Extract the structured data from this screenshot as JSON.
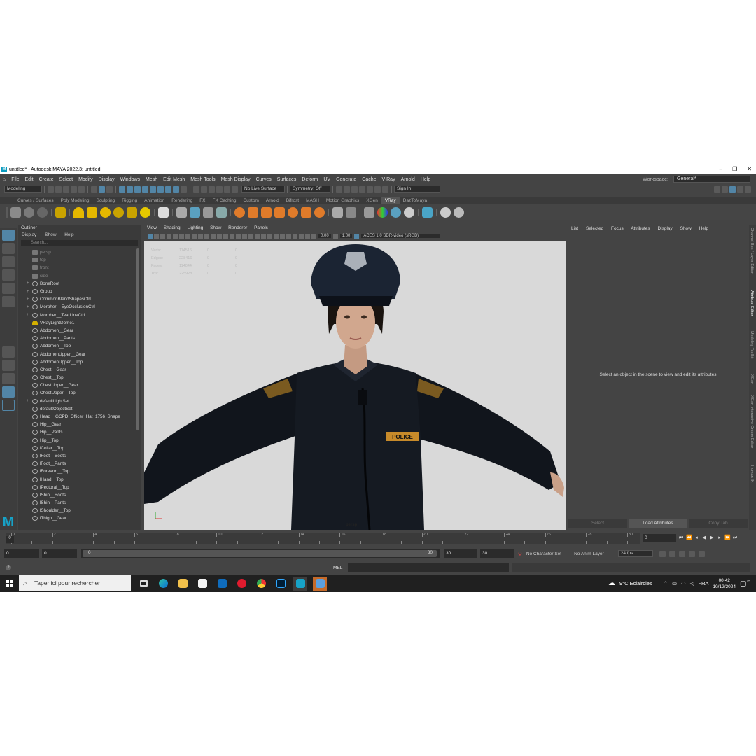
{
  "window": {
    "title": "untitled* - Autodesk MAYA 2022.3: untitled"
  },
  "menu": [
    "File",
    "Edit",
    "Create",
    "Select",
    "Modify",
    "Display",
    "Windows",
    "Mesh",
    "Edit Mesh",
    "Mesh Tools",
    "Mesh Display",
    "Curves",
    "Surfaces",
    "Deform",
    "UV",
    "Generate",
    "Cache",
    "V-Ray",
    "Arnold",
    "Help"
  ],
  "workspace": {
    "label": "Workspace:",
    "value": "General*"
  },
  "status": {
    "mode": "Modeling",
    "live_surface": "No Live Surface",
    "symmetry": "Symmetry: Off",
    "sign_in": "Sign In"
  },
  "shelf_tabs": [
    "Curves / Surfaces",
    "Poly Modeling",
    "Sculpting",
    "Rigging",
    "Animation",
    "Rendering",
    "FX",
    "FX Caching",
    "Custom",
    "Arnold",
    "Bifrost",
    "MASH",
    "Motion Graphics",
    "XGen",
    "VRay",
    "DazToMaya"
  ],
  "shelf_active": "VRay",
  "outliner": {
    "title": "Outliner",
    "menu": [
      "Display",
      "Show",
      "Help"
    ],
    "search_placeholder": "Search...",
    "items": [
      {
        "label": "persp",
        "kind": "cam",
        "exp": ""
      },
      {
        "label": "top",
        "kind": "cam",
        "exp": ""
      },
      {
        "label": "front",
        "kind": "cam",
        "exp": ""
      },
      {
        "label": "side",
        "kind": "cam",
        "exp": ""
      },
      {
        "label": "BoneRoot",
        "kind": "node",
        "exp": "+"
      },
      {
        "label": "Group",
        "kind": "node",
        "exp": "+"
      },
      {
        "label": "CommonBlendShapesCtrl",
        "kind": "node",
        "exp": "+"
      },
      {
        "label": "Morpher__EyeOcclusionCtrl",
        "kind": "node",
        "exp": "+"
      },
      {
        "label": "Morpher__TearLineCtrl",
        "kind": "node",
        "exp": "+"
      },
      {
        "label": "VRayLightDome1",
        "kind": "light",
        "exp": ""
      },
      {
        "label": "Abdomen__Gear",
        "kind": "mesh",
        "exp": ""
      },
      {
        "label": "Abdomen__Pants",
        "kind": "mesh",
        "exp": ""
      },
      {
        "label": "Abdomen__Top",
        "kind": "mesh",
        "exp": ""
      },
      {
        "label": "AbdomenUpper__Gear",
        "kind": "mesh",
        "exp": ""
      },
      {
        "label": "AbdomenUpper__Top",
        "kind": "mesh",
        "exp": ""
      },
      {
        "label": "Chest__Gear",
        "kind": "mesh",
        "exp": ""
      },
      {
        "label": "Chest__Top",
        "kind": "mesh",
        "exp": ""
      },
      {
        "label": "ChestUpper__Gear",
        "kind": "mesh",
        "exp": ""
      },
      {
        "label": "ChestUpper__Top",
        "kind": "mesh",
        "exp": ""
      },
      {
        "label": "defaultLightSet",
        "kind": "mesh",
        "exp": "+"
      },
      {
        "label": "defaultObjectSet",
        "kind": "mesh",
        "exp": ""
      },
      {
        "label": "Head__GCPD_Officer_Hat_1756_Shape",
        "kind": "mesh",
        "exp": ""
      },
      {
        "label": "Hip__Gear",
        "kind": "mesh",
        "exp": ""
      },
      {
        "label": "Hip__Pants",
        "kind": "mesh",
        "exp": ""
      },
      {
        "label": "Hip__Top",
        "kind": "mesh",
        "exp": ""
      },
      {
        "label": "lCollar__Top",
        "kind": "mesh",
        "exp": ""
      },
      {
        "label": "lFoot__Boots",
        "kind": "mesh",
        "exp": ""
      },
      {
        "label": "lFoot__Pants",
        "kind": "mesh",
        "exp": ""
      },
      {
        "label": "lForearm__Top",
        "kind": "mesh",
        "exp": ""
      },
      {
        "label": "lHand__Top",
        "kind": "mesh",
        "exp": ""
      },
      {
        "label": "lPectoral__Top",
        "kind": "mesh",
        "exp": ""
      },
      {
        "label": "lShin__Boots",
        "kind": "mesh",
        "exp": ""
      },
      {
        "label": "lShin__Pants",
        "kind": "mesh",
        "exp": ""
      },
      {
        "label": "lShoulder__Top",
        "kind": "mesh",
        "exp": ""
      },
      {
        "label": "lThigh__Gear",
        "kind": "mesh",
        "exp": ""
      }
    ]
  },
  "viewport": {
    "menu": [
      "View",
      "Shading",
      "Lighting",
      "Show",
      "Renderer",
      "Panels"
    ],
    "exposure": "0.00",
    "gamma": "1.00",
    "colorspace": "ACES 1.0 SDR-video (sRGB)",
    "camera": "persp",
    "hud": [
      {
        "label": "Verts:",
        "a": "114516",
        "b": "0",
        "c": "0"
      },
      {
        "label": "Edges:",
        "a": "228416",
        "b": "0",
        "c": "0"
      },
      {
        "label": "Faces:",
        "a": "114044",
        "b": "0",
        "c": "0"
      },
      {
        "label": "Tris:",
        "a": "225928",
        "b": "0",
        "c": "0"
      }
    ],
    "badge_text": "POLICE"
  },
  "attributes": {
    "menu": [
      "List",
      "Selected",
      "Focus",
      "Attributes",
      "Display",
      "Show",
      "Help"
    ],
    "message": "Select an object in the scene to view and edit its attributes",
    "buttons": [
      "Select",
      "Load Attributes",
      "Copy Tab"
    ]
  },
  "side_tabs": [
    "Channel Box / Layer Editor",
    "Attribute Editor",
    "Modeling Toolkit",
    "XGen",
    "XGen Interactive Groom Editor",
    "Human IK"
  ],
  "timeline": {
    "ticks": [
      0,
      2,
      4,
      6,
      8,
      10,
      12,
      14,
      16,
      18,
      20,
      22,
      24,
      26,
      28,
      30
    ],
    "current": "0",
    "frame_field": "0"
  },
  "range": {
    "start": "0",
    "inner_start": "0",
    "slider_start": "0",
    "slider_end": "30",
    "end": "30",
    "outer_end": "30",
    "character_set": "No Character Set",
    "anim_layer": "No Anim Layer",
    "fps": "24 fps"
  },
  "command": {
    "lang": "MEL"
  },
  "taskbar": {
    "search": "Taper ici pour rechercher",
    "weather": "9°C  Eclaircies",
    "lang": "FRA",
    "time": "00:42",
    "date": "10/12/2024",
    "notif": "15"
  },
  "colors": {
    "accent": "#5285a6",
    "viewport_bg": "#d9d9d9",
    "panel": "#444444"
  }
}
